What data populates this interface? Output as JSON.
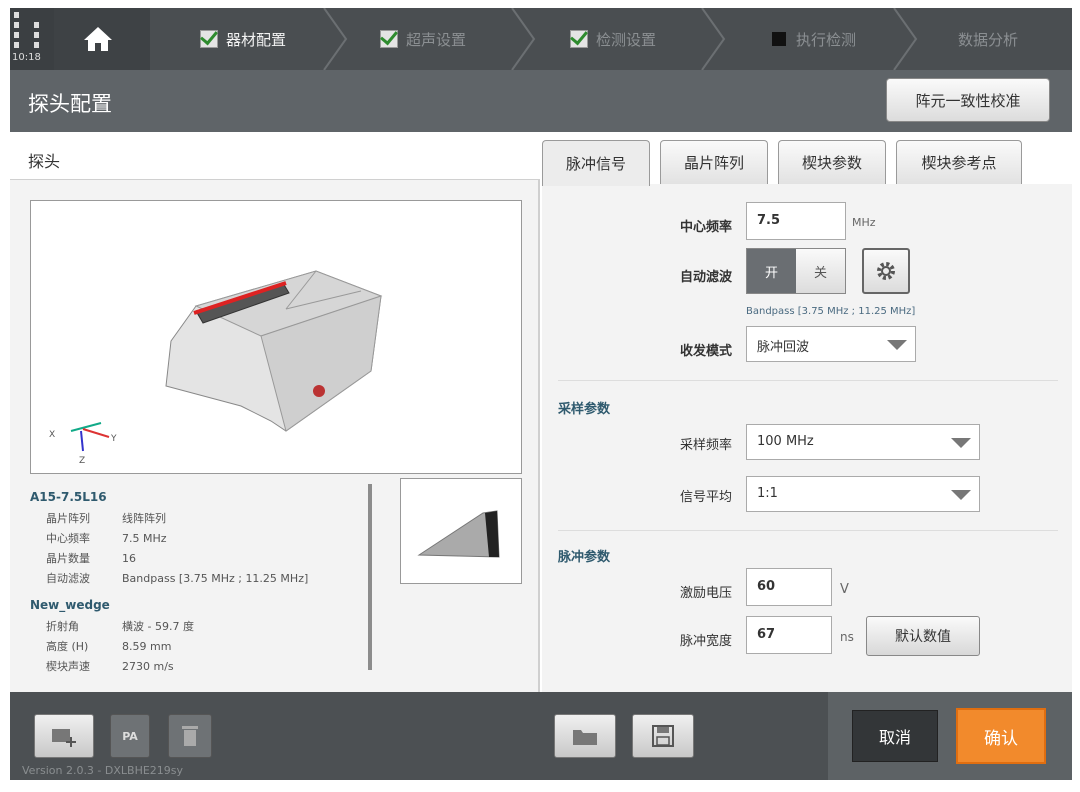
{
  "status": {
    "time": "10:18"
  },
  "nav": {
    "home_icon": "home-icon",
    "steps": [
      {
        "label": "器材配置",
        "state": "done"
      },
      {
        "label": "超声设置",
        "state": "done"
      },
      {
        "label": "检测设置",
        "state": "done"
      },
      {
        "label": "执行检测",
        "state": "pending"
      },
      {
        "label": "数据分析",
        "state": "none"
      }
    ]
  },
  "header": {
    "title": "探头配置",
    "calibration_button": "阵元一致性校准"
  },
  "probe_panel": {
    "title": "探头",
    "probe": {
      "name": "A15-7.5L16",
      "rows": [
        {
          "key": "晶片阵列",
          "value": "线阵阵列"
        },
        {
          "key": "中心频率",
          "value": "7.5 MHz"
        },
        {
          "key": "晶片数量",
          "value": "16"
        },
        {
          "key": "自动滤波",
          "value": "Bandpass [3.75 MHz ; 11.25 MHz]"
        }
      ]
    },
    "wedge": {
      "name": "New_wedge",
      "rows": [
        {
          "key": "折射角",
          "value": "横波 - 59.7 度"
        },
        {
          "key": "高度 (H)",
          "value": "8.59 mm"
        },
        {
          "key": "楔块声速",
          "value": "2730 m/s"
        }
      ]
    },
    "axes": {
      "x": "X",
      "y": "Y",
      "z": "Z"
    }
  },
  "tabs": [
    "脉冲信号",
    "晶片阵列",
    "楔块参数",
    "楔块参考点"
  ],
  "pulse": {
    "center_freq_label": "中心频率",
    "center_freq_value": "7.5",
    "center_freq_unit": "MHz",
    "auto_filter_label": "自动滤波",
    "toggle_on": "开",
    "toggle_off": "关",
    "filter_note": "Bandpass [3.75 MHz ; 11.25 MHz]",
    "tx_mode_label": "收发模式",
    "tx_mode_value": "脉冲回波"
  },
  "sampling": {
    "title": "采样参数",
    "rate_label": "采样频率",
    "rate_value": "100 MHz",
    "avg_label": "信号平均",
    "avg_value": "1:1"
  },
  "pulse_params": {
    "title": "脉冲参数",
    "voltage_label": "激励电压",
    "voltage_value": "60",
    "voltage_unit": "V",
    "width_label": "脉冲宽度",
    "width_value": "67",
    "width_unit": "ns",
    "default_button": "默认数值"
  },
  "footer": {
    "pa_label": "PA",
    "version": "Version 2.0.3 - DXLBHE219sy",
    "cancel": "取消",
    "confirm": "确认"
  },
  "colors": {
    "accent": "#f28a2c",
    "check": "#2e8b2e",
    "title_blue": "#2f5a6e"
  }
}
